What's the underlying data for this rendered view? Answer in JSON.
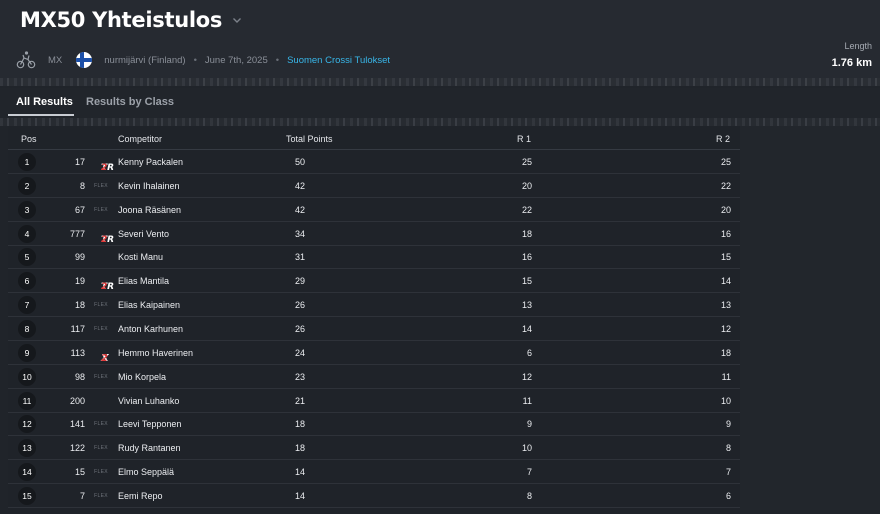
{
  "event": {
    "title": "MX50 Yhteistulos",
    "discipline": "MX",
    "location": "nurmijärvi (Finland)",
    "date": "June 7th, 2025",
    "organizer": "Suomen Crossi Tulokset",
    "length_label": "Length",
    "length_value": "1.76 km"
  },
  "icons": {
    "bike": "motocross-bike-icon",
    "flag": "finland-flag-icon",
    "dropdown": "chevron-down-icon"
  },
  "colors": {
    "accent_link": "#38b6e8",
    "brand_red": "#e03a3a"
  },
  "tabs": [
    {
      "label": "All Results",
      "active": true
    },
    {
      "label": "Results by Class",
      "active": false
    }
  ],
  "table": {
    "headers": {
      "pos": "Pos",
      "competitor": "Competitor",
      "total": "Total Points",
      "r1": "R 1",
      "r2": "R 2"
    },
    "rows": [
      {
        "pos": "1",
        "number": "17",
        "brand": "tr",
        "brand_text": "TR",
        "brand_accent": "2",
        "name": "Kenny Packalen",
        "total": "50",
        "r1": "25",
        "r2": "25"
      },
      {
        "pos": "2",
        "number": "8",
        "brand": "flex",
        "brand_text": "FLEX",
        "brand_accent": "",
        "name": "Kevin Ihalainen",
        "total": "42",
        "r1": "20",
        "r2": "22"
      },
      {
        "pos": "3",
        "number": "67",
        "brand": "flex",
        "brand_text": "FLEX",
        "brand_accent": "",
        "name": "Joona Räsänen",
        "total": "42",
        "r1": "22",
        "r2": "20"
      },
      {
        "pos": "4",
        "number": "777",
        "brand": "tr",
        "brand_text": "TR",
        "brand_accent": "2",
        "name": "Severi Vento",
        "total": "34",
        "r1": "18",
        "r2": "16"
      },
      {
        "pos": "5",
        "number": "99",
        "brand": "none",
        "brand_text": "",
        "brand_accent": "",
        "name": "Kosti Manu",
        "total": "31",
        "r1": "16",
        "r2": "15"
      },
      {
        "pos": "6",
        "number": "19",
        "brand": "tr",
        "brand_text": "TR",
        "brand_accent": "2",
        "name": "Elias Mantila",
        "total": "29",
        "r1": "15",
        "r2": "14"
      },
      {
        "pos": "7",
        "number": "18",
        "brand": "flex",
        "brand_text": "FLEX",
        "brand_accent": "",
        "name": "Elias Kaipainen",
        "total": "26",
        "r1": "13",
        "r2": "13"
      },
      {
        "pos": "8",
        "number": "117",
        "brand": "flex",
        "brand_text": "FLEX",
        "brand_accent": "",
        "name": "Anton Karhunen",
        "total": "26",
        "r1": "14",
        "r2": "12"
      },
      {
        "pos": "9",
        "number": "113",
        "brand": "x2",
        "brand_text": "X",
        "brand_accent": "2",
        "name": "Hemmo Haverinen",
        "total": "24",
        "r1": "6",
        "r2": "18"
      },
      {
        "pos": "10",
        "number": "98",
        "brand": "flex",
        "brand_text": "FLEX",
        "brand_accent": "",
        "name": "Mio Korpela",
        "total": "23",
        "r1": "12",
        "r2": "11"
      },
      {
        "pos": "11",
        "number": "200",
        "brand": "none",
        "brand_text": "",
        "brand_accent": "",
        "name": "Vivian Luhanko",
        "total": "21",
        "r1": "11",
        "r2": "10"
      },
      {
        "pos": "12",
        "number": "141",
        "brand": "flex",
        "brand_text": "FLEX",
        "brand_accent": "",
        "name": "Leevi Tepponen",
        "total": "18",
        "r1": "9",
        "r2": "9"
      },
      {
        "pos": "13",
        "number": "122",
        "brand": "flex",
        "brand_text": "FLEX",
        "brand_accent": "",
        "name": "Rudy Rantanen",
        "total": "18",
        "r1": "10",
        "r2": "8"
      },
      {
        "pos": "14",
        "number": "15",
        "brand": "flex",
        "brand_text": "FLEX",
        "brand_accent": "",
        "name": "Elmo Seppälä",
        "total": "14",
        "r1": "7",
        "r2": "7"
      },
      {
        "pos": "15",
        "number": "7",
        "brand": "flex",
        "brand_text": "FLEX",
        "brand_accent": "",
        "name": "Eemi Repo",
        "total": "14",
        "r1": "8",
        "r2": "6"
      }
    ]
  }
}
